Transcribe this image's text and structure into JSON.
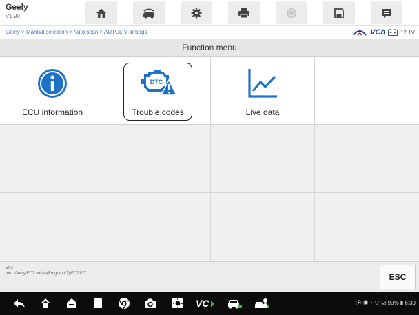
{
  "app": {
    "name": "Geely",
    "version": "V1.90"
  },
  "toolbar": {
    "buttons": [
      {
        "name": "home-icon"
      },
      {
        "name": "vehicle-swap-icon"
      },
      {
        "name": "settings-gear-icon"
      },
      {
        "name": "print-icon"
      },
      {
        "name": "help-icon"
      },
      {
        "name": "save-icon"
      },
      {
        "name": "data-logging-icon"
      }
    ]
  },
  "breadcrumb": {
    "path": "Geely > Manual selection > Auto scan > AUTOLIV airbags"
  },
  "vci": {
    "label": "VCb",
    "voltage": "12.1V"
  },
  "title": "Function menu",
  "functions": [
    {
      "label": "ECU information",
      "icon": "info-icon",
      "highlighted": false
    },
    {
      "label": "Trouble codes",
      "icon": "dtc-engine-warning-icon",
      "highlighted": true
    },
    {
      "label": "Live data",
      "icon": "line-chart-icon",
      "highlighted": false
    }
  ],
  "info": {
    "vin": "VIN:",
    "vehicle": "Info: Geely/EC7 series(Emgrand 7)/EC713T"
  },
  "esc_label": "ESC",
  "status": {
    "text": "⦿  ◉ ↑ ▽  ☑ 90%  ▮ 6:39"
  },
  "colors": {
    "accent_blue": "#1f73c7",
    "breadcrumb_blue": "#4a6fb5",
    "navbar": "#0c0c0c",
    "highlight_border": "#222222"
  }
}
